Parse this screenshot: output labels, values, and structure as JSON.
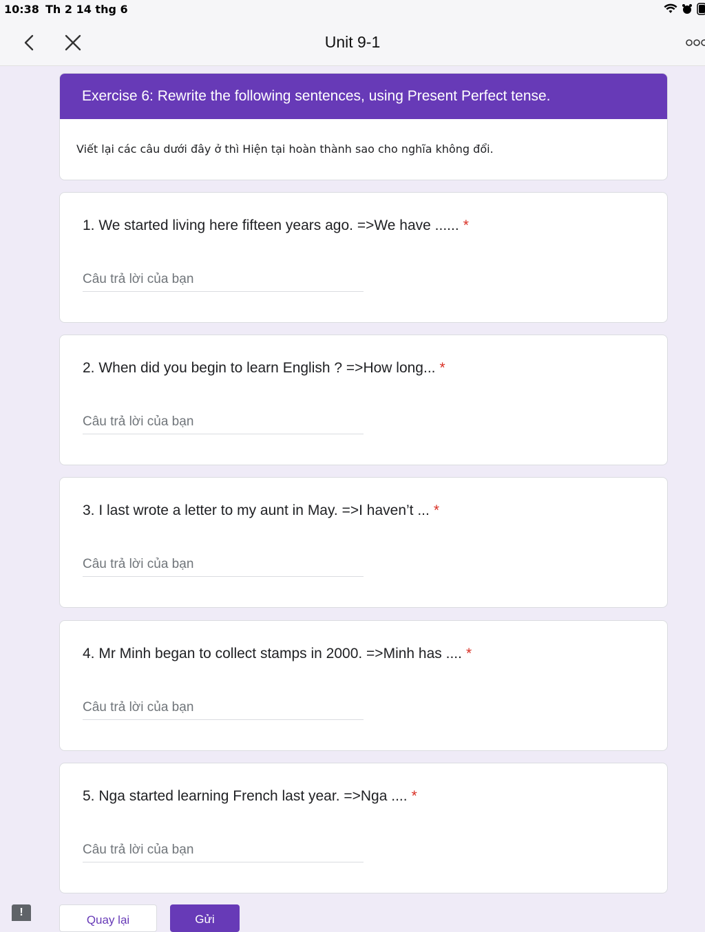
{
  "status_bar": {
    "time": "10:38",
    "date": "Th 2 14 thg 6",
    "icons": [
      "wifi-icon",
      "alarm-icon",
      "battery-icon"
    ]
  },
  "nav": {
    "title": "Unit 9-1",
    "icons": [
      "chevron-left-icon",
      "close-icon",
      "more-icon"
    ]
  },
  "form": {
    "accent_color": "#673ab7",
    "header_title": "Exercise 6: Rewrite the following sentences, using Present Perfect tense.",
    "header_description": "Viết lại các câu dưới đây ở thì Hiện tại hoàn thành sao cho nghĩa không đổi.",
    "answer_placeholder": "Câu trả lời của bạn",
    "required_mark": "*",
    "questions": [
      {
        "text": "1. We started living here fifteen years ago. =>We have ......",
        "answer": ""
      },
      {
        "text": "2. When did you begin to learn English ? =>How long...",
        "answer": ""
      },
      {
        "text": "3. I last wrote a letter to my aunt in May. =>I haven’t ...",
        "answer": ""
      },
      {
        "text": "4. Mr Minh began to collect stamps in 2000. =>Minh has ....",
        "answer": ""
      },
      {
        "text": "5. Nga started learning French last year. =>Nga ....",
        "answer": ""
      }
    ]
  },
  "footer": {
    "feedback_label": "!",
    "back_label": "Quay lại",
    "submit_label": "Gửi"
  }
}
